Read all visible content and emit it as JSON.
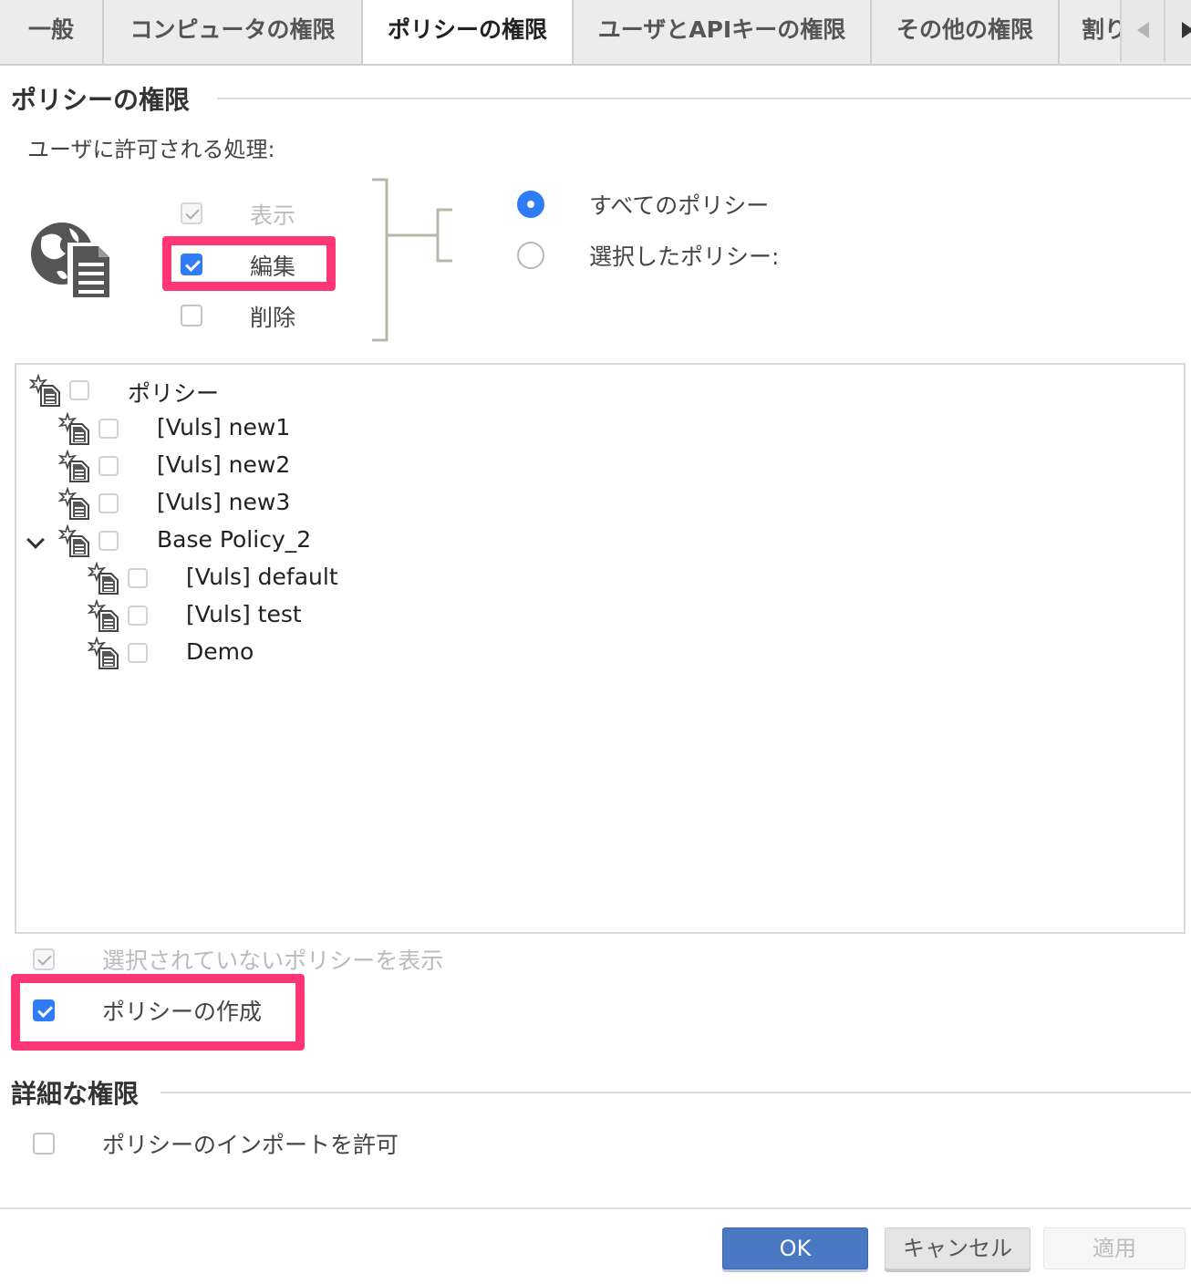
{
  "tabs": [
    {
      "label": "一般"
    },
    {
      "label": "コンピュータの権限"
    },
    {
      "label": "ポリシーの権限"
    },
    {
      "label": "ユーザとAPIキーの権限"
    },
    {
      "label": "その他の権限"
    },
    {
      "label": "割り"
    }
  ],
  "active_tab": "ポリシーの権限",
  "policy_permissions": {
    "section_title": "ポリシーの権限",
    "allowed_actions_label": "ユーザに許可される処理:",
    "actions": {
      "view": {
        "label": "表示",
        "checked": true,
        "disabled": true
      },
      "edit": {
        "label": "編集",
        "checked": true,
        "disabled": false
      },
      "delete": {
        "label": "削除",
        "checked": false,
        "disabled": false
      }
    },
    "scope": {
      "all": {
        "label": "すべてのポリシー",
        "selected": true
      },
      "selected": {
        "label": "選択したポリシー:",
        "selected": false
      }
    }
  },
  "policy_tree": {
    "root": {
      "label": "ポリシー",
      "checked": false
    },
    "items": [
      {
        "label": "[Vuls] new1",
        "level": 1,
        "checked": false
      },
      {
        "label": "[Vuls] new2",
        "level": 1,
        "checked": false
      },
      {
        "label": "[Vuls] new3",
        "level": 1,
        "checked": false
      },
      {
        "label": "Base Policy_2",
        "level": 1,
        "checked": false,
        "expanded": true
      },
      {
        "label": "[Vuls] default",
        "level": 2,
        "checked": false
      },
      {
        "label": "[Vuls] test",
        "level": 2,
        "checked": false
      },
      {
        "label": "Demo",
        "level": 2,
        "checked": false
      }
    ]
  },
  "show_unselected": {
    "label": "選択されていないポリシーを表示",
    "checked": true,
    "disabled": true
  },
  "create_policy": {
    "label": "ポリシーの作成",
    "checked": true
  },
  "advanced": {
    "section_title": "詳細な権限",
    "allow_import": {
      "label": "ポリシーのインポートを許可",
      "checked": false
    }
  },
  "buttons": {
    "ok": "OK",
    "cancel": "キャンセル",
    "apply": "適用"
  },
  "colors": {
    "accent": "#2f7cf6",
    "highlight": "#ff3574",
    "ok_button": "#4a78c3"
  },
  "icons": {
    "policy": "policy-document-icon",
    "globe": "globe-document-icon"
  }
}
